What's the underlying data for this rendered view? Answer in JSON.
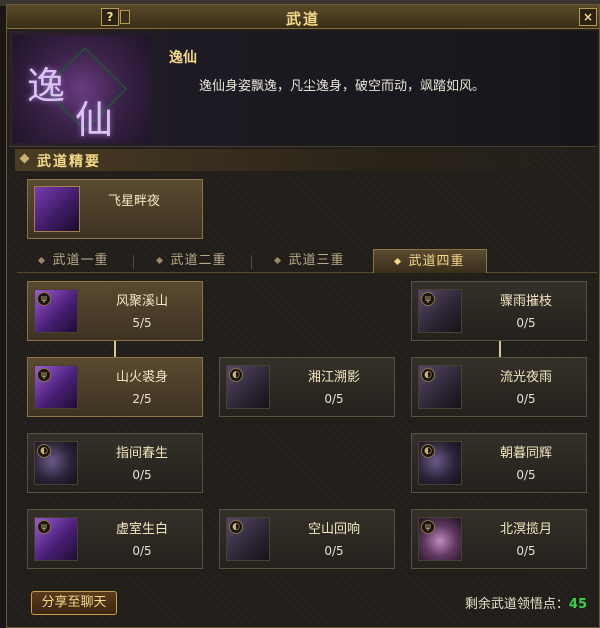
{
  "window": {
    "title": "武道",
    "help_label": "?",
    "close_label": "×"
  },
  "header": {
    "emblem_glyph_1": "逸",
    "emblem_glyph_2": "仙",
    "skill_name": "逸仙",
    "skill_desc": "逸仙身姿飘逸，凡尘逸身，破空而动，飒踏如风。"
  },
  "section": {
    "heading": "武道精要",
    "key_skill": {
      "name": "飞星畔夜",
      "icon": "purple-dash-icon"
    }
  },
  "tabs": [
    {
      "label": "武道一重",
      "active": false
    },
    {
      "label": "武道二重",
      "active": false
    },
    {
      "label": "武道三重",
      "active": false
    },
    {
      "label": "武道四重",
      "active": true
    }
  ],
  "talents": [
    {
      "name": "风聚溪山",
      "level": "5/5",
      "active": true,
      "icon": "purple-slash-icon"
    },
    {
      "name": "骤雨摧枝",
      "level": "0/5",
      "active": false,
      "icon": "rain-icon"
    },
    {
      "name": "山火裘身",
      "level": "2/5",
      "active": true,
      "icon": "purple-slash-icon"
    },
    {
      "name": "湘江溯影",
      "level": "0/5",
      "active": false,
      "icon": "wave-icon"
    },
    {
      "name": "流光夜雨",
      "level": "0/5",
      "active": false,
      "icon": "rain-icon"
    },
    {
      "name": "指间春生",
      "level": "0/5",
      "active": false,
      "icon": "orb-icon"
    },
    {
      "name": "朝暮同辉",
      "level": "0/5",
      "active": false,
      "icon": "moon-icon"
    },
    {
      "name": "虚室生白",
      "level": "0/5",
      "active": false,
      "icon": "purple-slash-icon"
    },
    {
      "name": "空山回响",
      "level": "0/5",
      "active": false,
      "icon": "wave-icon"
    },
    {
      "name": "北溟揽月",
      "level": "0/5",
      "active": false,
      "icon": "swirl-icon"
    }
  ],
  "footer": {
    "share_label": "分享至聊天",
    "points_label": "剩余武道领悟点：",
    "points_value": "45"
  },
  "colors": {
    "accent_gold": "#f3d98a",
    "points_green": "#3ad04a",
    "skill_purple": "#9a5ad0"
  }
}
